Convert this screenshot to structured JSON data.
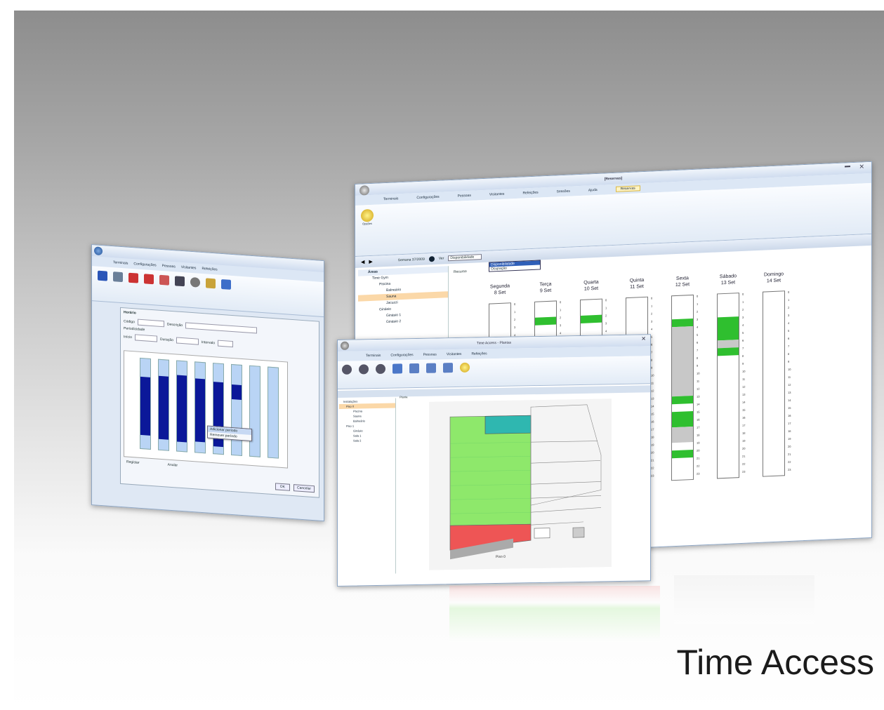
{
  "caption": "Time Access",
  "right_window": {
    "title": "[Reservas]",
    "tabs": [
      "Terminais",
      "Configurações",
      "Pessoas",
      "Visitantes",
      "Refeições",
      "Sessões",
      "Ajuda",
      "Reservas"
    ],
    "context_tab": "Reservas",
    "ribbon_button": "Opções",
    "toolbar": {
      "week_label": "Semana 37/2009",
      "view_label": "Ver",
      "view_value": "Disponibilidade",
      "view_options": [
        "Disponibilidade",
        "Ocupação"
      ]
    },
    "tree": {
      "root": "Áreas",
      "items": [
        "Time Gym",
        "Piscina",
        "Balneário",
        "Sauna",
        "Jacuzzi",
        "Ginásio",
        "Ginásio 1",
        "Ginásio 2"
      ]
    },
    "main_header": "Recurso",
    "days": [
      {
        "name": "Segunda",
        "date": "8 Set"
      },
      {
        "name": "Terça",
        "date": "9 Set"
      },
      {
        "name": "Quarta",
        "date": "10 Set"
      },
      {
        "name": "Quinta",
        "date": "11 Set"
      },
      {
        "name": "Sexta",
        "date": "12 Set"
      },
      {
        "name": "Sábado",
        "date": "13 Set"
      },
      {
        "name": "Domingo",
        "date": "14 Set"
      }
    ],
    "hours": [
      "0",
      "1",
      "2",
      "3",
      "4",
      "5",
      "6",
      "7",
      "8",
      "9",
      "10",
      "11",
      "12",
      "13",
      "14",
      "15",
      "16",
      "17",
      "18",
      "19",
      "20",
      "21",
      "22",
      "23"
    ]
  },
  "left_window": {
    "tabs": [
      "Terminais",
      "Configurações",
      "Pessoas",
      "Visitantes",
      "Refeições",
      "Sessões",
      "Ajuda"
    ],
    "section_title": "Horário",
    "fields": {
      "codigo": "Código",
      "descricao": "Descrição",
      "periodo": "Periodicidade",
      "inicio": "Início",
      "duracao": "Duração",
      "intervalo": "Intervalo"
    },
    "context_menu": [
      "Adicionar período",
      "Remover período"
    ],
    "bottom_labels": [
      "Registar",
      "Anular"
    ],
    "ok": "OK",
    "cancel": "Cancelar"
  },
  "center_window": {
    "title": "Time Access - Plantas",
    "tree_root": "Instalações",
    "tree_items": [
      "Piso 0",
      "Piscina",
      "Sauna",
      "Balneário",
      "Piso 1",
      "Ginásio",
      "Sala 1",
      "Sala 2"
    ],
    "main_header": "Planta",
    "plan_label": "Piso 0"
  },
  "colors": {
    "green_free": "#2fbf2f",
    "light_green": "#8ee86b",
    "teal": "#2fb7b0",
    "red": "#ee5555",
    "navy": "#0b1899",
    "ribbon_blue": "#dce7f5"
  }
}
